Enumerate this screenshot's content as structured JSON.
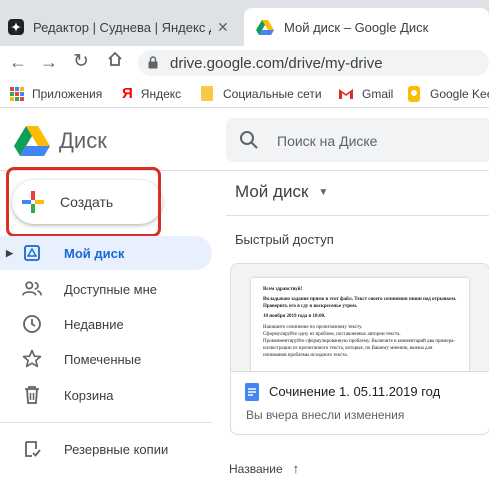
{
  "tabs": [
    {
      "title": "Редактор | Суднева | Яндекс Дзен",
      "icon": "dzen-icon"
    },
    {
      "title": "Мой диск – Google Диск",
      "icon": "google-drive-icon"
    }
  ],
  "address": {
    "url": "drive.google.com/drive/my-drive"
  },
  "bookmarks": [
    {
      "label": "Приложения"
    },
    {
      "label": "Яндекс"
    },
    {
      "label": "Социальные сети"
    },
    {
      "label": "Gmail"
    },
    {
      "label": "Google Keep"
    }
  ],
  "drive": {
    "app_name": "Диск",
    "search_placeholder": "Поиск на Диске",
    "create_label": "Создать",
    "nav": [
      {
        "label": "Мой диск"
      },
      {
        "label": "Доступные мне"
      },
      {
        "label": "Недавние"
      },
      {
        "label": "Помеченные"
      },
      {
        "label": "Корзина"
      },
      {
        "label": "Резервные копии"
      }
    ],
    "breadcrumb": "Мой диск",
    "quick_access_title": "Быстрый доступ",
    "file": {
      "name": "Сочинение 1. 05.11.2019 год",
      "subtitle": "Вы вчера внесли изменения",
      "preview": {
        "greeting": "Всем здравствуй!",
        "intro": "Вкладываю задание прямо в этот файл. Текст своего сочинения пиши под отрывком. Проверить его я сду в воскресенье утром.",
        "deadline": "10 ноября 2019 года в 18:00.",
        "lines": [
          "Напишите сочинение по прочитанному тексту.",
          "Сформулируйте одну из проблем, поставленных автором текста.",
          "Прокомментируйте сформулированную проблему. Включите в комментарий два примера-иллюстрации из прочитанного текста, которые, по Вашему мнению, важны для понимания проблемы исходного текста."
        ]
      }
    },
    "sort_label": "Название"
  }
}
